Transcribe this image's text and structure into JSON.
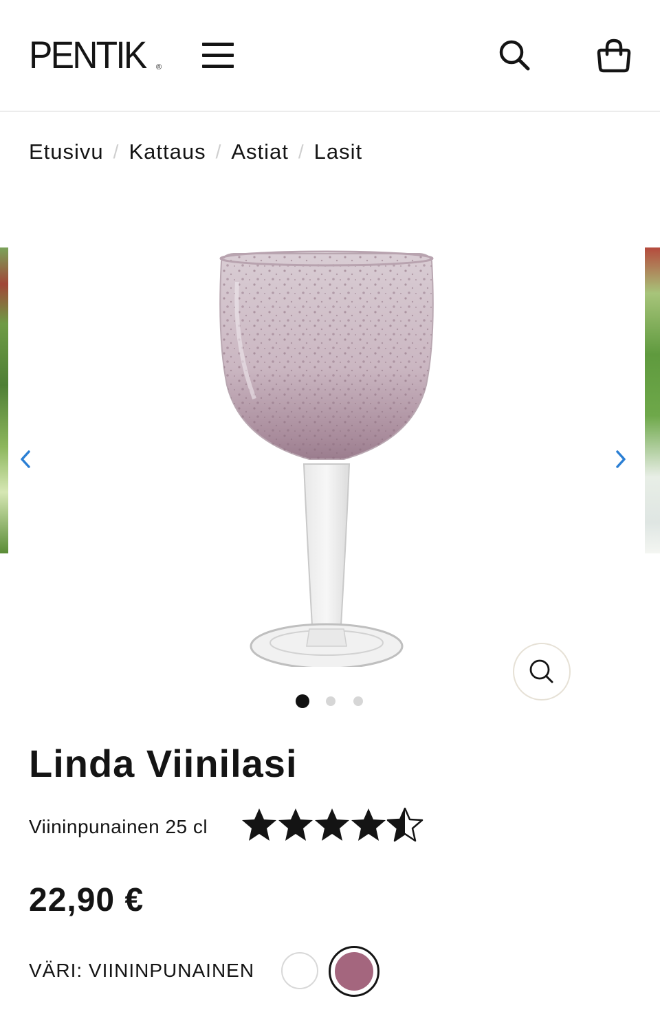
{
  "header": {
    "logo_text": "PENTIK",
    "logo_mark": "®",
    "icons": [
      "hamburger-menu-icon",
      "search-icon",
      "shopping-bag-icon"
    ]
  },
  "breadcrumb": {
    "items": [
      "Etusivu",
      "Kattaus",
      "Astiat",
      "Lasit"
    ],
    "separator": "/"
  },
  "gallery": {
    "image_count": 3,
    "active_index": 0,
    "icons": [
      "chevron-left-icon",
      "chevron-right-icon",
      "zoom-icon"
    ],
    "arrow_color": "#2b7fd4"
  },
  "product": {
    "title": "Linda Viinilasi",
    "variant": "Viininpunainen 25 cl",
    "rating": 4.5,
    "rating_max": 5,
    "price": "22,90 €",
    "color_label": "VÄRI: VIININPUNAINEN",
    "swatches": [
      {
        "name": "white",
        "color": "#ffffff",
        "selected": false
      },
      {
        "name": "viininpunainen",
        "color": "#a4667e",
        "selected": true
      }
    ]
  }
}
